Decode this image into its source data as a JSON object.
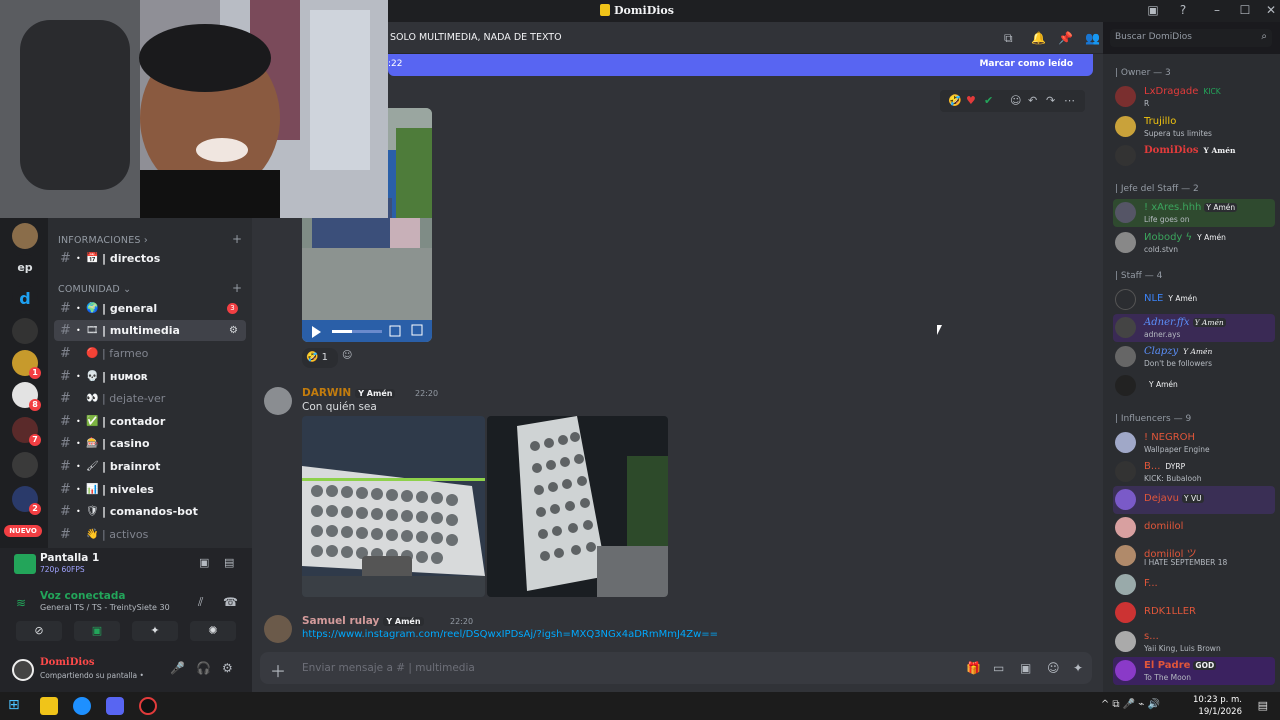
{
  "window": {
    "title": "DomiDios",
    "controls": [
      "minimize",
      "maximize",
      "close"
    ]
  },
  "channel_header": {
    "title": "SOLO MULTIMEDIA, NADA DE TEXTO",
    "search_placeholder": "Buscar DomiDios"
  },
  "new_messages_bar": {
    "time": ":22",
    "mark_read": "Marcar como leído"
  },
  "categories": {
    "info": "INFORMACIONES",
    "community": "COMUNIDAD"
  },
  "channels": [
    {
      "emoji": "📅",
      "name": "| directos",
      "muted": false
    },
    {
      "emoji": "🌍",
      "name": "| general",
      "muted": false,
      "badge": "3"
    },
    {
      "emoji": "🎞",
      "name": "| multimedia",
      "muted": false,
      "active": true
    },
    {
      "emoji": "🔴",
      "name": "| farmeo",
      "muted": true
    },
    {
      "emoji": "💀",
      "name": "| ʜᴜᴍᴏʀ",
      "muted": false
    },
    {
      "emoji": "👀",
      "name": "| dejate-ver",
      "muted": true
    },
    {
      "emoji": "✅",
      "name": "| contador",
      "muted": false
    },
    {
      "emoji": "🎰",
      "name": "| casino",
      "muted": false
    },
    {
      "emoji": "🖌",
      "name": "| brainrot",
      "muted": false
    },
    {
      "emoji": "📊",
      "name": "| niveles",
      "muted": false
    },
    {
      "emoji": "🛡",
      "name": "| comandos-bot",
      "muted": false
    },
    {
      "emoji": "👋",
      "name": "| activos",
      "muted": true
    }
  ],
  "servers": [
    {
      "label": "",
      "color": "#8a6d4a"
    },
    {
      "label": "ep",
      "color": "#1e1f22"
    },
    {
      "label": "d",
      "color": "#1e1f22"
    },
    {
      "label": "",
      "color": "#333"
    },
    {
      "label": "",
      "color": "#c79a2c",
      "badge": "1"
    },
    {
      "label": "",
      "color": "#e3e3e3",
      "badge": "8"
    },
    {
      "label": "",
      "color": "#5a2a2a",
      "badge": "7"
    },
    {
      "label": "",
      "color": "#3a3a3a"
    },
    {
      "label": "",
      "color": "#2a3a6a",
      "badge": "2"
    }
  ],
  "server_new_badge": "NUEVO",
  "stream": {
    "title": "Pantalla 1",
    "quality": "720p 60FPS"
  },
  "voice": {
    "status": "Voz conectada",
    "channel": "General TS / TS - TreintySiete 30"
  },
  "user": {
    "name": "DomiDios",
    "status": "Compartiendo su pantalla •"
  },
  "reaction": {
    "emoji": "🤣",
    "count": "1"
  },
  "messages": [
    {
      "author": "DARWIN",
      "tag": "Y Amén",
      "time": "22:20",
      "text": "Con quién sea",
      "author_color": "#c27c0e"
    },
    {
      "author": "Samuel rulay",
      "tag": "Y Amén",
      "time": "22:20",
      "link": "https://www.instagram.com/reel/DSQwxIPDsAj/?igsh=MXQ3NGx4aDRmMmJ4Zw==",
      "author_color": "#d39b9b"
    }
  ],
  "composer": {
    "placeholder": "Enviar mensaje a #",
    "channel": "| multimedia"
  },
  "member_groups": [
    {
      "label": "| Owner — 3",
      "members": [
        {
          "name": "LxDragade",
          "status": "R",
          "tag": "KICK",
          "color": "#e23b3b"
        },
        {
          "name": "Trujillo",
          "status": "Supera tus limites",
          "color": "#f1c40f"
        },
        {
          "name": "DomiDios",
          "status": "",
          "tag": "Y Amén",
          "color": "#e23b3b"
        }
      ]
    },
    {
      "label": "| Jefe del Staff — 2",
      "members": [
        {
          "name": "! xAres.hhh",
          "status": "Life goes on",
          "tag": "Y Amén",
          "color": "#3ba55d"
        },
        {
          "name": "Иobody ϟ",
          "status": "cold.stvn",
          "tag": "Y Amén",
          "color": "#3ba55d"
        }
      ]
    },
    {
      "label": "| Staff — 4",
      "members": [
        {
          "name": "NLE",
          "status": "",
          "tag": "Y Amén",
          "color": "#3b82f6"
        },
        {
          "name": "Adner.ffx",
          "status": "adner.ays",
          "tag": "Y Amén",
          "color": "#3b82f6"
        },
        {
          "name": "Clapzy",
          "status": "Don't be followers",
          "tag": "Y Amén",
          "color": "#3b82f6"
        },
        {
          "name": "",
          "status": "",
          "tag": "Y Amén",
          "color": "#3b82f6"
        }
      ]
    },
    {
      "label": "| Influencers — 9",
      "members": [
        {
          "name": "! NEGROH",
          "status": "Wallpaper Engine",
          "color": "#e0563a"
        },
        {
          "name": "B...",
          "status": "KICK: Bubalooh",
          "tag": "DYRP",
          "color": "#e0563a"
        },
        {
          "name": "Dejavu",
          "status": "",
          "tag": "Y VU",
          "color": "#e0563a"
        },
        {
          "name": "domiilol",
          "status": "",
          "color": "#e0563a"
        },
        {
          "name": "domiilol ツ",
          "status": "I HATE SEPTEMBER 18",
          "color": "#e0563a"
        },
        {
          "name": "F...",
          "status": "",
          "color": "#e0563a"
        },
        {
          "name": "RDK1LLER",
          "status": "",
          "color": "#e0563a"
        },
        {
          "name": "s...",
          "status": "Yaii King, Luis Brown",
          "color": "#e0563a"
        },
        {
          "name": "El Padre",
          "status": "To The Moon",
          "tag": "GOD",
          "color": "#e0563a"
        }
      ]
    }
  ],
  "clock": {
    "time": "10:23 p. m.",
    "date": "19/1/2026"
  }
}
